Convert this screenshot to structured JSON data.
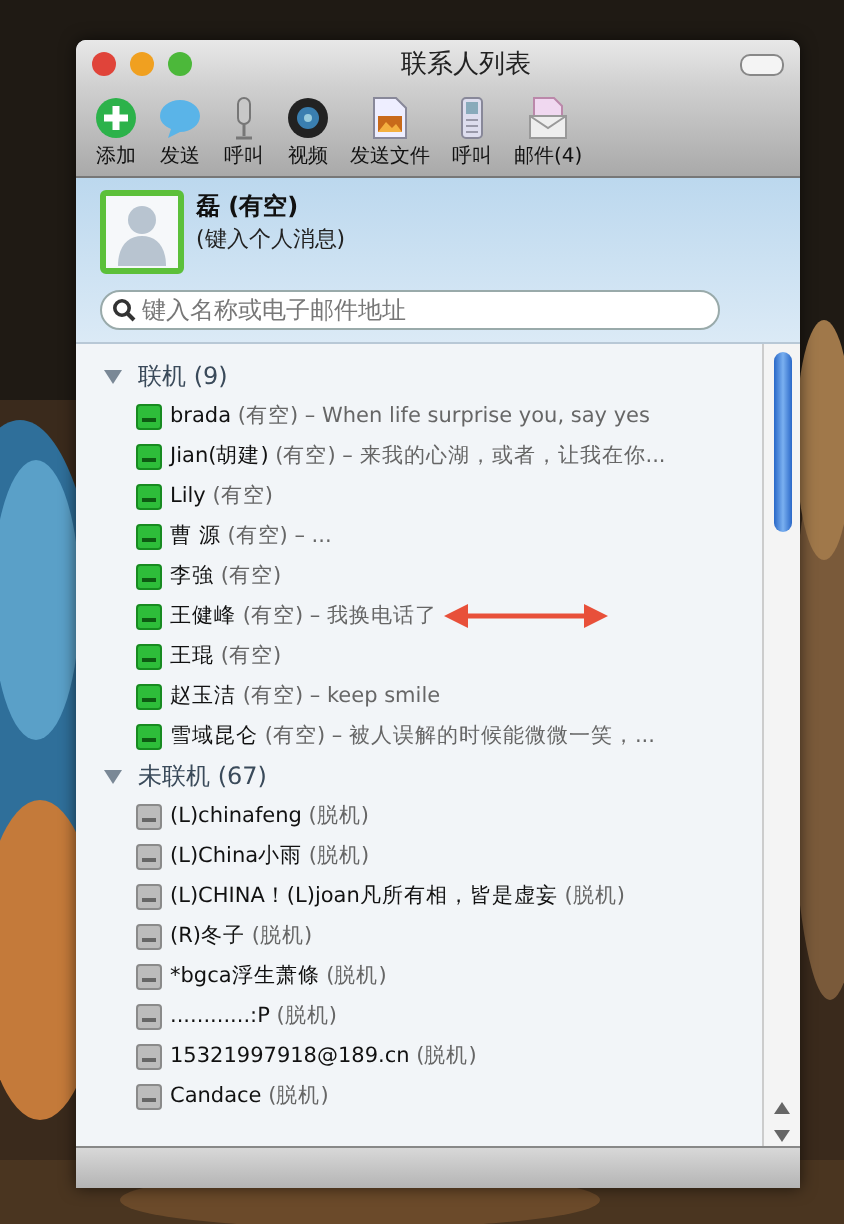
{
  "window": {
    "title": "联系人列表"
  },
  "toolbar": [
    {
      "label": "添加",
      "kind": "add"
    },
    {
      "label": "发送",
      "kind": "chat"
    },
    {
      "label": "呼叫",
      "kind": "mic"
    },
    {
      "label": "视频",
      "kind": "cam"
    },
    {
      "label": "发送文件",
      "kind": "file"
    },
    {
      "label": "呼叫",
      "kind": "phone"
    },
    {
      "label": "邮件(4)",
      "kind": "mail"
    }
  ],
  "profile": {
    "name": "磊 (有空)",
    "message": "(键入个人消息)"
  },
  "search": {
    "placeholder": "键入名称或电子邮件地址"
  },
  "groups": [
    {
      "name": "联机 (9)",
      "expanded": true,
      "contacts": [
        {
          "name": "brada",
          "status": "(有空)",
          "message": "– When life surprise you, say yes",
          "online": true,
          "redacted": false
        },
        {
          "name": "Jian(胡建)",
          "status": "(有空)",
          "message": "– 来我的心湖，或者，让我在你...",
          "online": true,
          "redacted": false
        },
        {
          "name": "Lily",
          "status": "(有空)",
          "online": true,
          "redacted": false
        },
        {
          "name": "曹 源",
          "status": "(有空)",
          "message": "– ...",
          "online": true,
          "redacted": false
        },
        {
          "name": "李強",
          "status": "(有空)",
          "online": true,
          "redacted": false
        },
        {
          "name": "王健峰",
          "status": "(有空)",
          "message": "– 我换电话了",
          "online": true,
          "redacted": true
        },
        {
          "name": "王琨",
          "status": "(有空)",
          "online": true,
          "redacted": false
        },
        {
          "name": "赵玉洁",
          "status": "(有空)",
          "message": "– keep smile",
          "online": true,
          "redacted": false
        },
        {
          "name": "雪域昆仑",
          "status": "(有空)",
          "message": "– 被人误解的时候能微微一笑，...",
          "online": true,
          "redacted": false
        }
      ]
    },
    {
      "name": "未联机 (67)",
      "expanded": true,
      "contacts": [
        {
          "name": "(L)chinafeng",
          "status": "(脱机)",
          "online": false,
          "redacted": false
        },
        {
          "name": "(L)China小雨",
          "status": "(脱机)",
          "online": false,
          "redacted": false
        },
        {
          "name": "(L)CHINA！(L)joan凡所有相，皆是虚妄",
          "status": "(脱机)",
          "online": false,
          "redacted": false
        },
        {
          "name": "(R)冬子",
          "status": "(脱机)",
          "online": false,
          "redacted": false
        },
        {
          "name": "*bgca浮生萧條",
          "status": "(脱机)",
          "online": false,
          "redacted": false
        },
        {
          "name": "............:P",
          "status": "(脱机)",
          "online": false,
          "redacted": false
        },
        {
          "name": "15321997918@189.cn",
          "status": "(脱机)",
          "online": false,
          "redacted": false
        },
        {
          "name": "Candace",
          "status": "(脱机)",
          "online": false,
          "redacted": false
        }
      ]
    }
  ]
}
